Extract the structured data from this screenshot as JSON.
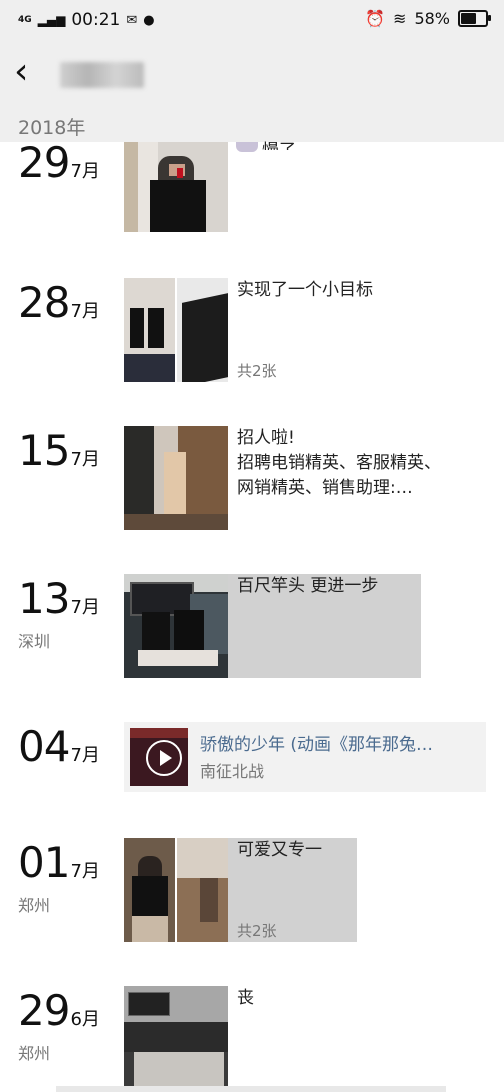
{
  "status": {
    "network": "4G",
    "time": "00:21",
    "battery_percent": "58%",
    "battery_level": 0.58,
    "icons": [
      "signal-icon",
      "mail-icon",
      "chat-bubble-icon",
      "alarm-icon",
      "wifi-icon",
      "battery-icon"
    ]
  },
  "nav": {
    "back_icon": "chevron-left-icon",
    "title_obscured": true
  },
  "year_header": "2018年",
  "entries": [
    {
      "day": "29",
      "month": "7月",
      "location": "",
      "text": "",
      "sub": ""
    },
    {
      "day": "28",
      "month": "7月",
      "location": "",
      "text": "实现了一个小目标",
      "sub": "共2张"
    },
    {
      "day": "15",
      "month": "7月",
      "location": "",
      "text_lines": [
        "招人啦!",
        "招聘电销精英、客服精英、",
        "网销精英、销售助理:…"
      ],
      "sub": ""
    },
    {
      "day": "13",
      "month": "7月",
      "location": "深圳",
      "text": "百尺竿头 更进一步",
      "sub": ""
    },
    {
      "day": "04",
      "month": "7月",
      "location": "",
      "share_title": "骄傲的少年 (动画《那年那兔…",
      "share_sub": "南征北战"
    },
    {
      "day": "01",
      "month": "7月",
      "location": "郑州",
      "text": "可爱又专一",
      "sub": "共2张"
    },
    {
      "day": "29",
      "month": "6月",
      "location": "郑州",
      "text": "丧",
      "sub": ""
    }
  ],
  "colors": {
    "header_bg": "#efefef",
    "link": "#4b6b8f",
    "secondary": "#777777"
  }
}
